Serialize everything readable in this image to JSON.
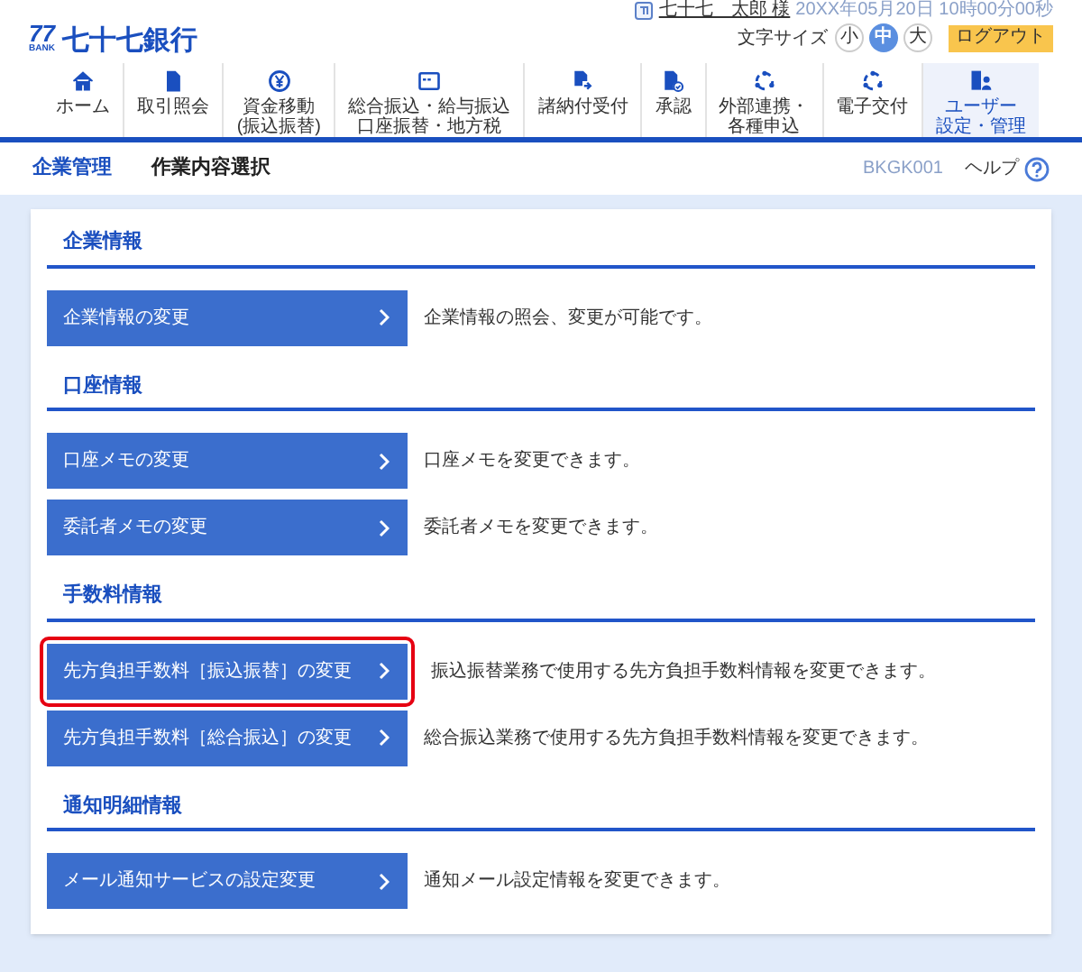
{
  "header": {
    "logo_mark": "77",
    "logo_sub": "BANK",
    "bank_name": "七十七銀行",
    "user_name": "七十七　太郎 様",
    "datetime": "20XX年05月20日 10時00分00秒",
    "font_size_label": "文字サイズ",
    "font_sizes": [
      {
        "label": "小",
        "selected": false
      },
      {
        "label": "中",
        "selected": true
      },
      {
        "label": "大",
        "selected": false
      }
    ],
    "logout": "ログアウト"
  },
  "nav": [
    {
      "lines": [
        "ホーム"
      ],
      "selected": false
    },
    {
      "lines": [
        "取引照会"
      ],
      "selected": false
    },
    {
      "lines": [
        "資金移動",
        "(振込振替)"
      ],
      "selected": false
    },
    {
      "lines": [
        "総合振込・給与振込",
        "口座振替・地方税"
      ],
      "selected": false
    },
    {
      "lines": [
        "諸納付受付"
      ],
      "selected": false
    },
    {
      "lines": [
        "承認"
      ],
      "selected": false
    },
    {
      "lines": [
        "外部連携・",
        "各種申込"
      ],
      "selected": false
    },
    {
      "lines": [
        "電子交付"
      ],
      "selected": false
    },
    {
      "lines": [
        "ユーザー",
        "設定・管理"
      ],
      "selected": true
    }
  ],
  "breadcrumb": {
    "parent": "企業管理",
    "title": "作業内容選択",
    "screen_id": "BKGK001",
    "help": "ヘルプ"
  },
  "sections": [
    {
      "title": "企業情報",
      "items": [
        {
          "label": "企業情報の変更",
          "description": "企業情報の照会、変更が可能です。",
          "highlighted": false
        }
      ]
    },
    {
      "title": "口座情報",
      "items": [
        {
          "label": "口座メモの変更",
          "description": "口座メモを変更できます。",
          "highlighted": false
        },
        {
          "label": "委託者メモの変更",
          "description": "委託者メモを変更できます。",
          "highlighted": false
        }
      ]
    },
    {
      "title": "手数料情報",
      "items": [
        {
          "label": "先方負担手数料［振込振替］の変更",
          "description": "振込振替業務で使用する先方負担手数料情報を変更できます。",
          "highlighted": true
        },
        {
          "label": "先方負担手数料［総合振込］の変更",
          "description": "総合振込業務で使用する先方負担手数料情報を変更できます。",
          "highlighted": false
        }
      ]
    },
    {
      "title": "通知明細情報",
      "items": [
        {
          "label": "メール通知サービスの設定変更",
          "description": "通知メール設定情報を変更できます。",
          "highlighted": false
        }
      ]
    }
  ]
}
